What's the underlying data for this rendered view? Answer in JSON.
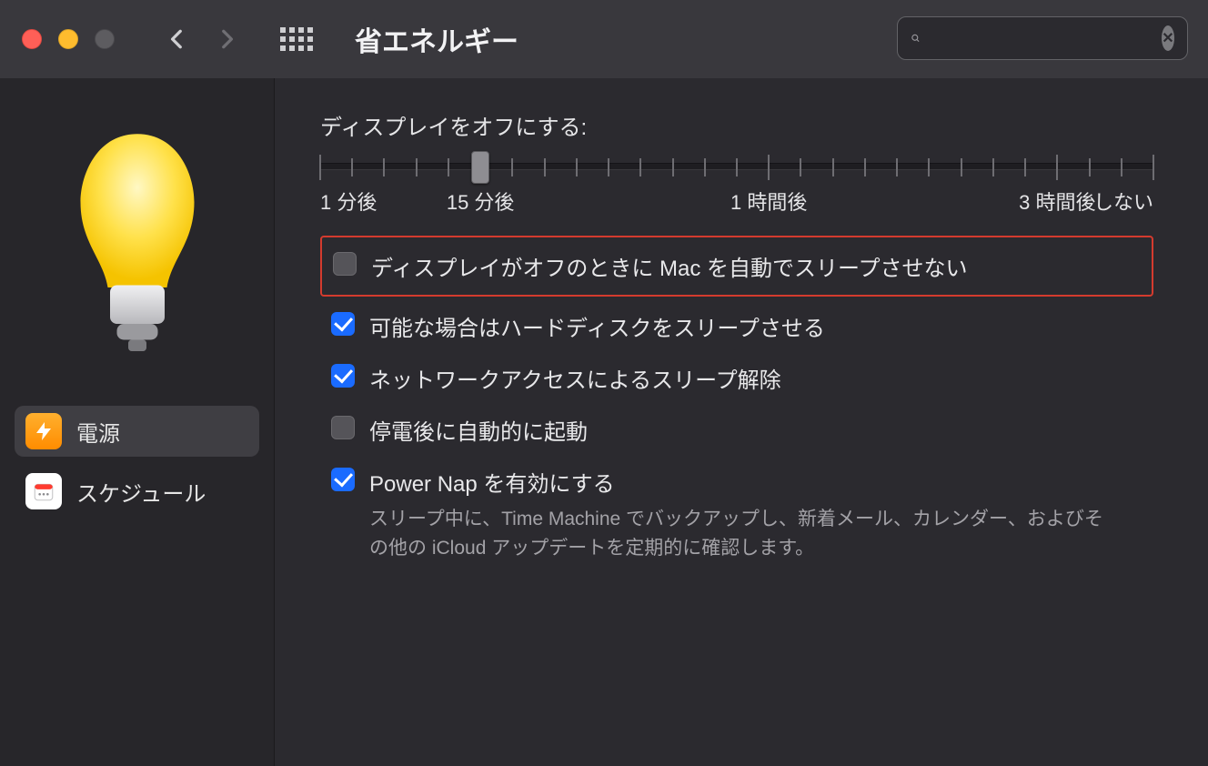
{
  "window": {
    "title": "省エネルギー"
  },
  "search": {
    "placeholder": ""
  },
  "sidebar": {
    "items": [
      {
        "id": "power",
        "label": "電源",
        "selected": true
      },
      {
        "id": "schedule",
        "label": "スケジュール",
        "selected": false
      }
    ]
  },
  "main": {
    "slider": {
      "title": "ディスプレイをオフにする:",
      "labels": [
        "1 分後",
        "15 分後",
        "1 時間後",
        "3 時間後",
        "しない"
      ],
      "value_index": 5,
      "tick_count": 27,
      "label_tick_indices": [
        0,
        5,
        14,
        23,
        26
      ]
    },
    "options": [
      {
        "id": "prevent-sleep",
        "checked": false,
        "highlight": true,
        "label": "ディスプレイがオフのときに Mac を自動でスリープさせない"
      },
      {
        "id": "hd-sleep",
        "checked": true,
        "label": "可能な場合はハードディスクをスリープさせる"
      },
      {
        "id": "wake-network",
        "checked": true,
        "label": "ネットワークアクセスによるスリープ解除"
      },
      {
        "id": "restart-power",
        "checked": false,
        "label": "停電後に自動的に起動"
      },
      {
        "id": "power-nap",
        "checked": true,
        "label": "Power Nap を有効にする",
        "sub": "スリープ中に、Time Machine でバックアップし、新着メール、カレンダー、およびその他の iCloud アップデートを定期的に確認します。"
      }
    ]
  }
}
